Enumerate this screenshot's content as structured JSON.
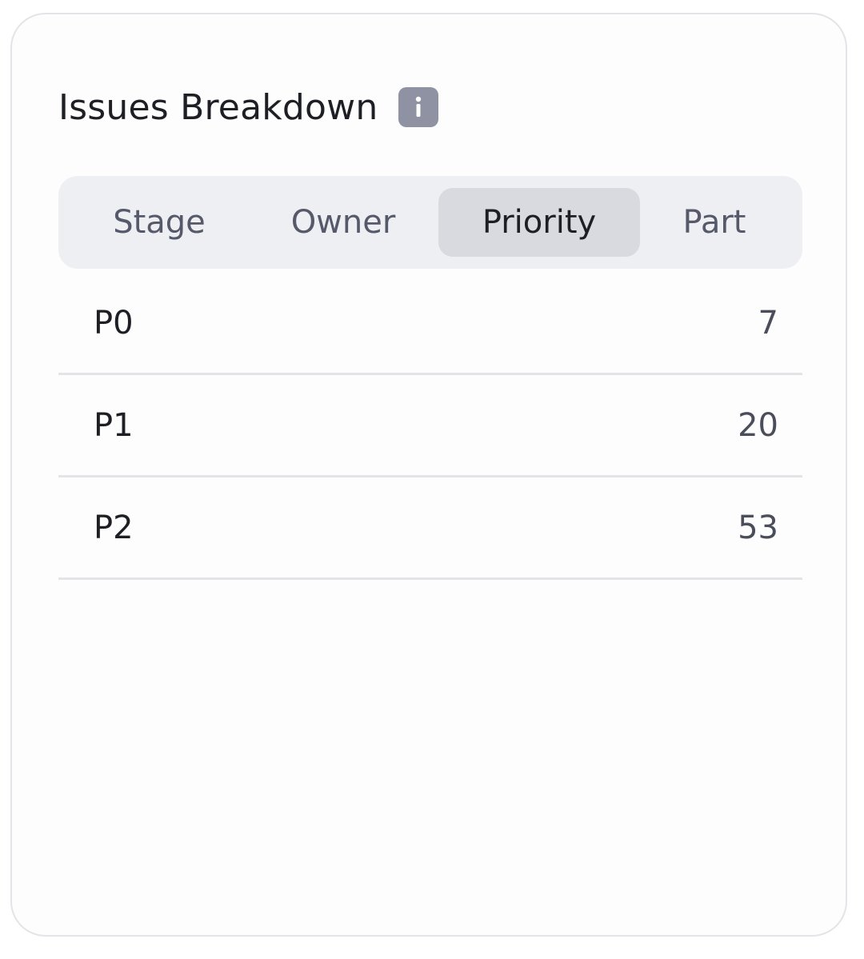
{
  "widget": {
    "title": "Issues Breakdown",
    "info_icon": "info-icon"
  },
  "tabs": [
    {
      "label": "Stage",
      "active": false
    },
    {
      "label": "Owner",
      "active": false
    },
    {
      "label": "Priority",
      "active": true
    },
    {
      "label": "Part",
      "active": false
    }
  ],
  "rows": [
    {
      "label": "P0",
      "value": "7"
    },
    {
      "label": "P1",
      "value": "20"
    },
    {
      "label": "P2",
      "value": "53"
    }
  ],
  "colors": {
    "card_border": "#e3e4e8",
    "tab_bar_bg": "#eeeff2",
    "tab_active_bg": "#d9dae0",
    "info_icon_bg": "#8e92a3"
  }
}
